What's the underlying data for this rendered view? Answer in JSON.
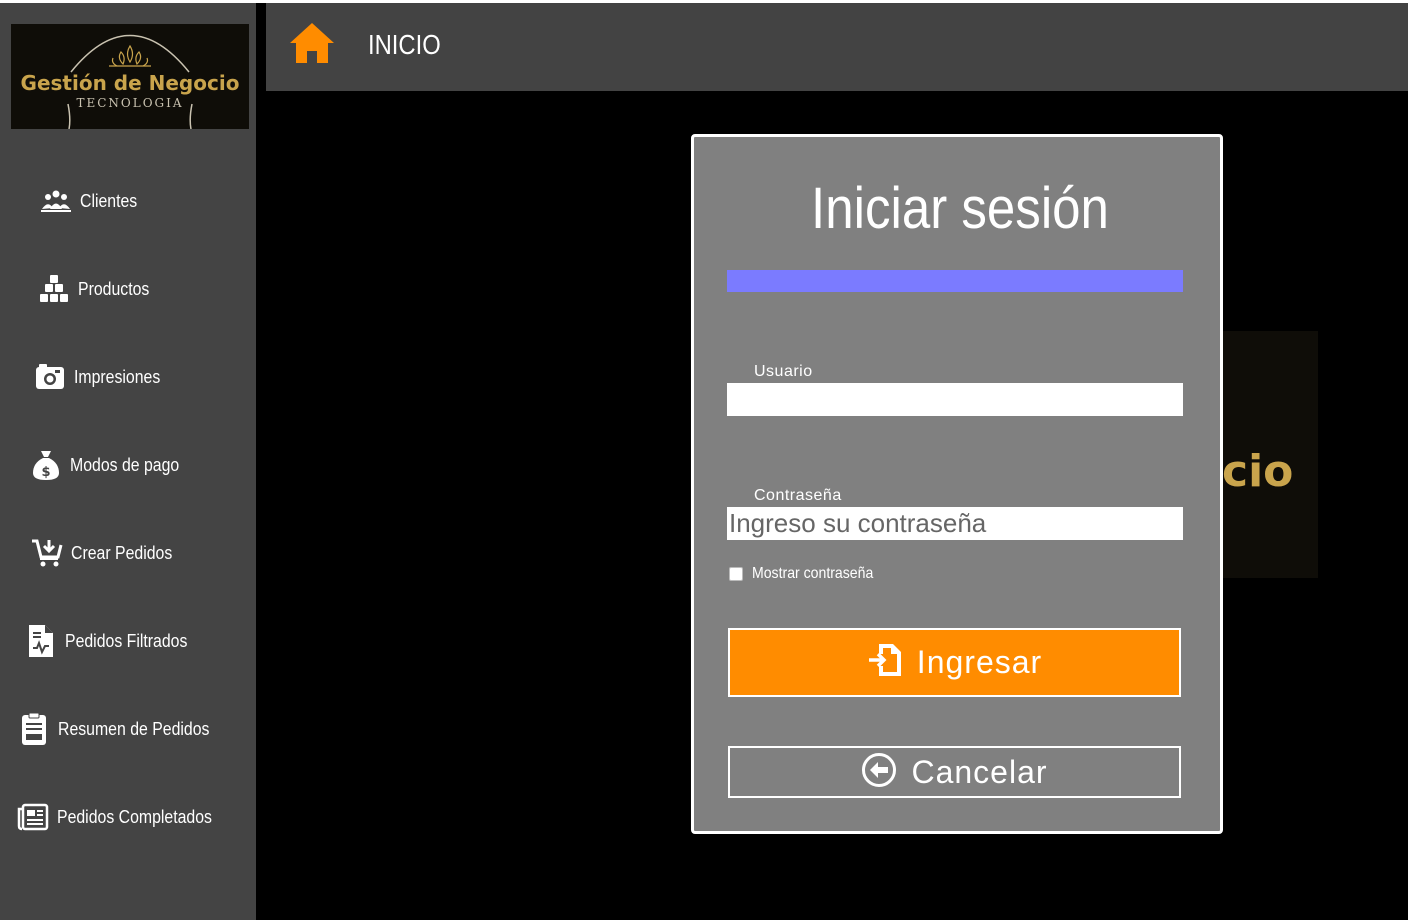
{
  "logo": {
    "title": "Gestión de Negocio",
    "subtitle": "TECNOLOGIA"
  },
  "sidebar": {
    "items": [
      {
        "label": "Clientes",
        "icon": "group-people-icon"
      },
      {
        "label": "Productos",
        "icon": "boxes-icon"
      },
      {
        "label": "Impresiones",
        "icon": "camera-icon"
      },
      {
        "label": "Modos de pago",
        "icon": "money-bag-icon"
      },
      {
        "label": "Crear Pedidos",
        "icon": "cart-download-icon"
      },
      {
        "label": "Pedidos Filtrados",
        "icon": "file-chart-icon"
      },
      {
        "label": "Resumen de Pedidos",
        "icon": "clipboard-icon"
      },
      {
        "label": "Pedidos Completados",
        "icon": "newspaper-icon"
      }
    ]
  },
  "header": {
    "title": "INICIO",
    "icon": "home-icon"
  },
  "background": {
    "partial_text": "cio"
  },
  "login": {
    "title": "Iniciar sesión",
    "user_label": "Usuario",
    "user_value": "",
    "password_label": "Contraseña",
    "password_placeholder": "Ingreso su contraseña",
    "show_password_label": "Mostrar contraseña",
    "show_password_checked": false,
    "submit_label": "Ingresar",
    "cancel_label": "Cancelar"
  },
  "colors": {
    "accent_orange": "#ff8c00",
    "sidebar_bg": "#444444",
    "header_bg": "#434343",
    "modal_bg": "#808080",
    "progress_bar": "#7b7bff",
    "logo_gold": "#c9a44c"
  }
}
